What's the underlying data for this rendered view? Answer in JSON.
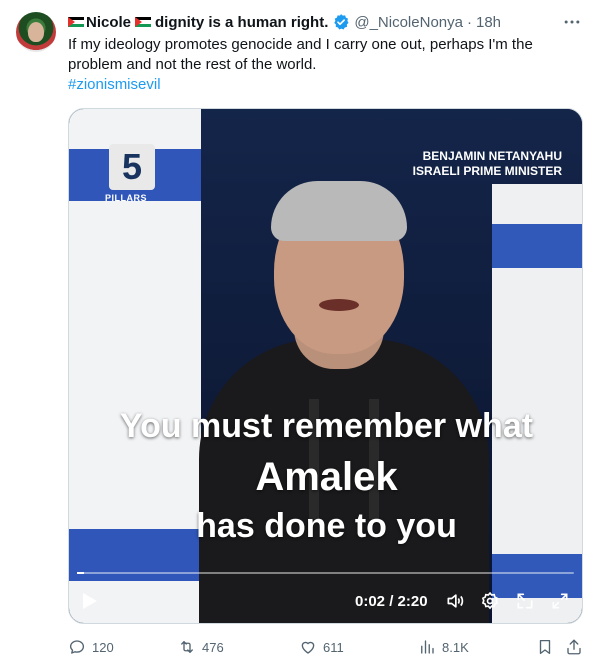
{
  "author": {
    "name_prefix": "Nicole",
    "name_suffix": "dignity is a human right.",
    "handle": "@_NicoleNonya",
    "separator": "·",
    "time": "18h"
  },
  "tweet": {
    "text": "If my ideology promotes genocide and I carry one out, perhaps I'm the problem and not the rest of the world.",
    "hashtag": "#zionismisevil"
  },
  "video": {
    "logo_number": "5",
    "logo_label": "PILLARS",
    "caption_name": "BENJAMIN NETANYAHU",
    "caption_title": "ISRAELI PRIME MINISTER",
    "subtitle_line1": "You must remember what",
    "subtitle_line2": "Amalek",
    "subtitle_line3": "has done to you",
    "timecode": "0:02 / 2:20",
    "progress": 0.015
  },
  "actions": {
    "replies": "120",
    "reposts": "476",
    "likes": "611",
    "views": "8.1K"
  },
  "icons": {
    "more": "more-icon",
    "verified": "verified-badge-icon",
    "play": "play-icon",
    "volume": "volume-icon",
    "settings": "settings-icon",
    "pip": "picture-in-picture-icon",
    "fullscreen": "fullscreen-icon",
    "reply": "reply-icon",
    "repost": "repost-icon",
    "like": "heart-icon",
    "views": "analytics-icon",
    "bookmark": "bookmark-icon",
    "share": "share-icon"
  },
  "colors": {
    "accent": "#1d9bf0",
    "muted": "#536471",
    "text": "#0f1419"
  }
}
